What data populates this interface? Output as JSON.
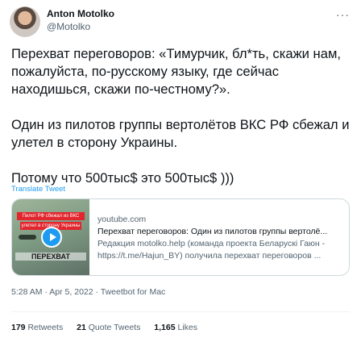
{
  "author": {
    "name": "Anton Motolko",
    "handle": "@Motolko"
  },
  "tweet": {
    "paragraphs": [
      "Перехват переговоров: «Тимурчик, бл*ть, скажи нам, пожалуйста, по-русскому языку, где сейчас находишься, скажи по-честному?».",
      "Один из пилотов группы вертолётов ВКС РФ сбежал и улетел в сторону Украины.",
      "Потому что 500тыс$ это 500тыс$ )))"
    ],
    "translate_label": "Translate Tweet"
  },
  "card": {
    "domain": "youtube.com",
    "title": "Перехват переговоров: Один из пилотов группы вертолё...",
    "description": "Редакция motolko.help (команда проекта Беларускі Гаюн - https://t.me/Hajun_BY) получила перехват переговоров ...",
    "thumb_banner1": "Пилот РФ сбежал из ВКС",
    "thumb_banner2": "улетел в сторону Украины",
    "thumb_caption": "ПЕРЕХВАТ"
  },
  "meta": {
    "time": "5:28 AM",
    "date": "Apr 5, 2022",
    "source": "Tweetbot for Mac"
  },
  "stats": {
    "retweets_count": "179",
    "retweets_label": "Retweets",
    "quotes_count": "21",
    "quotes_label": "Quote Tweets",
    "likes_count": "1,165",
    "likes_label": "Likes"
  },
  "icons": {
    "more": "more-icon",
    "play": "play-icon"
  },
  "colors": {
    "link": "#1d9bf0",
    "secondary_text": "#536471",
    "primary_text": "#0f1419"
  }
}
